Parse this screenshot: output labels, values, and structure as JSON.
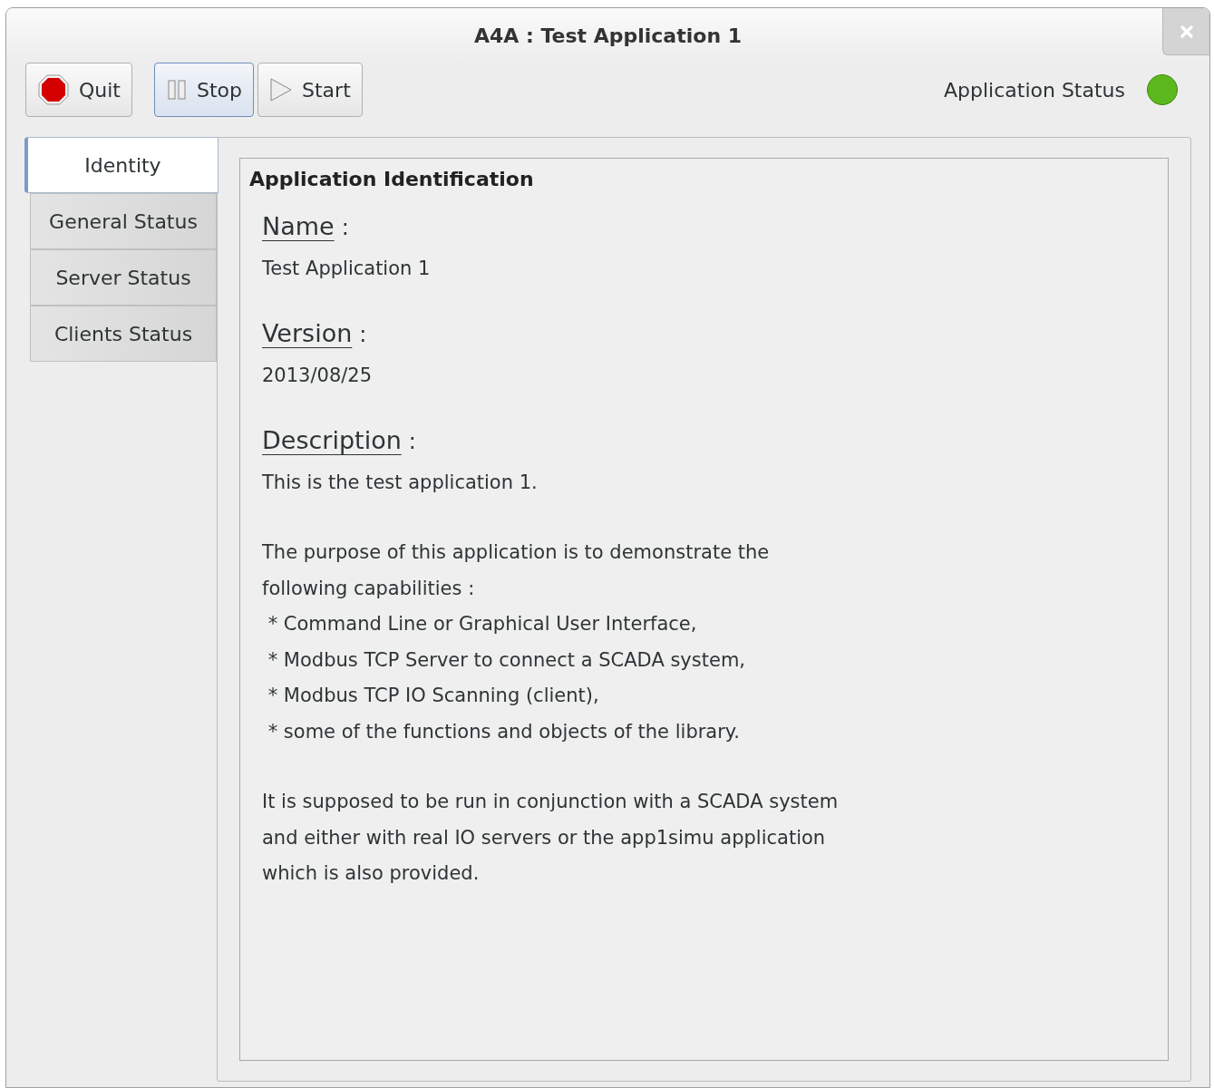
{
  "window": {
    "title": "A4A : Test Application 1"
  },
  "toolbar": [
    {
      "kind": "quit",
      "label": "Quit",
      "selected": false
    },
    {
      "kind": "stop",
      "label": "Stop",
      "selected": true
    },
    {
      "kind": "start",
      "label": "Start",
      "selected": false
    }
  ],
  "status": {
    "label": "Application Status",
    "color": "#5cb81c"
  },
  "tabs": [
    {
      "label": "Identity",
      "selected": true
    },
    {
      "label": "General Status",
      "selected": false
    },
    {
      "label": "Server Status",
      "selected": false
    },
    {
      "label": "Clients Status",
      "selected": false
    }
  ],
  "panel": {
    "title": "Application Identification",
    "fields": [
      {
        "label": "Name",
        "separator": ":",
        "paragraphs": [
          [
            "Test Application 1"
          ]
        ]
      },
      {
        "label": "Version",
        "separator": ":",
        "paragraphs": [
          [
            "2013/08/25"
          ]
        ]
      },
      {
        "label": "Description",
        "separator": ":",
        "paragraphs": [
          [
            "This is the test application 1."
          ],
          [
            "The purpose of this application is to demonstrate the",
            "following capabilities :",
            " * Command Line or Graphical User Interface,",
            " * Modbus TCP Server to connect a SCADA system,",
            " * Modbus TCP IO Scanning (client),",
            " * some of the functions and objects of the library."
          ],
          [
            "It is supposed to be run in conjunction with a SCADA system",
            "and either with real IO servers or the app1simu application",
            "which is also provided."
          ]
        ]
      }
    ]
  }
}
